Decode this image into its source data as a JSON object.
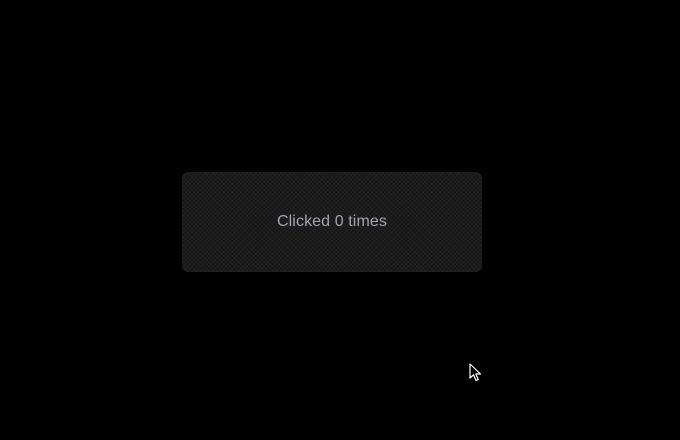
{
  "button": {
    "label": "Clicked 0 times"
  },
  "colors": {
    "background": "#000000",
    "button_fill": "#161616",
    "button_text": "#a3a3b3",
    "cursor_fill": "#000000",
    "cursor_stroke": "#ffffff"
  },
  "icons": {
    "cursor": "mouse-pointer-icon"
  }
}
